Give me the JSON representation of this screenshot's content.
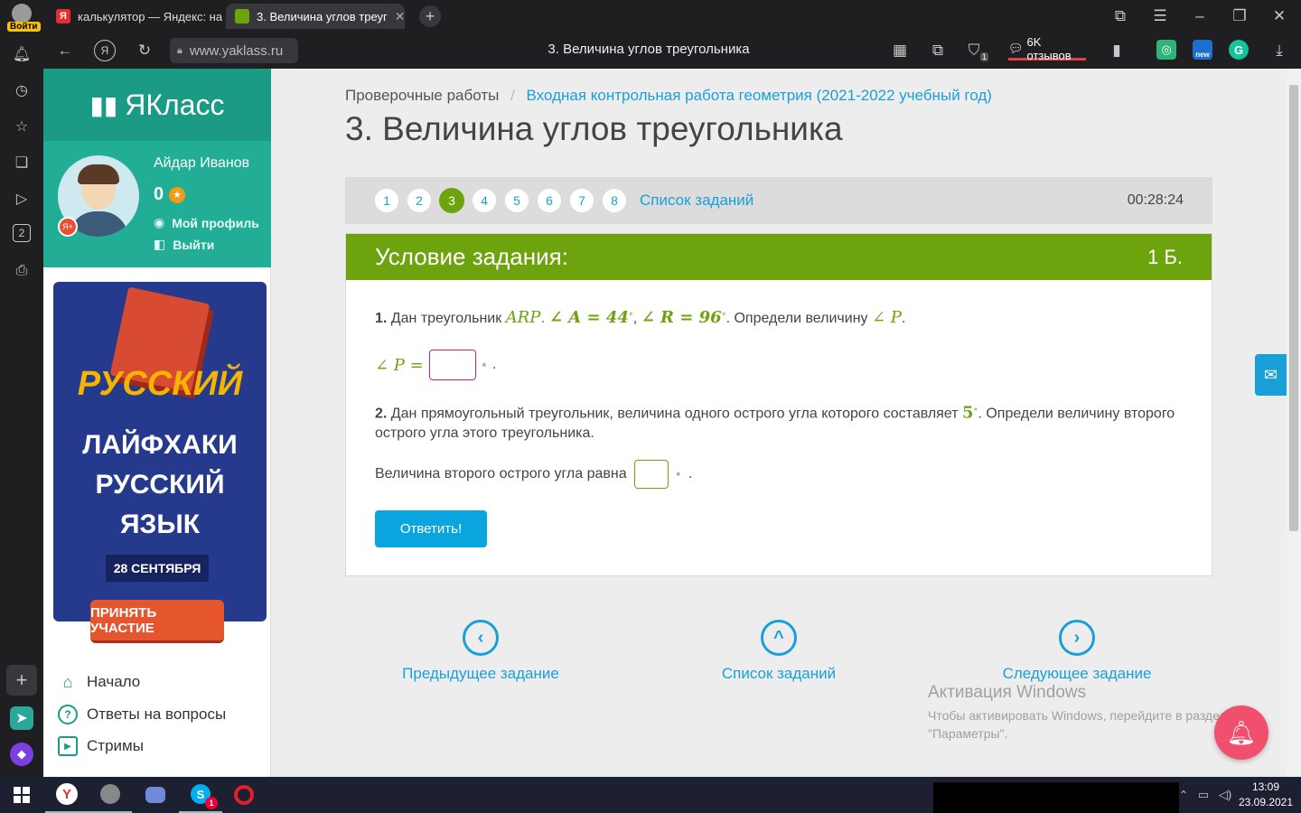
{
  "browser": {
    "login_label": "Войти",
    "tabs": [
      {
        "title": "калькулятор — Яндекс: на",
        "favicon": "Я"
      },
      {
        "title": "3. Величина углов треуг",
        "favicon": ""
      }
    ],
    "url": "www.yaklass.ru",
    "page_title": "3. Величина углов треугольника",
    "reviews": "6K отзывов",
    "new_badge": "new",
    "shield_count": "1",
    "rail_badge": "2"
  },
  "sidebar": {
    "logo": "ЯКласс",
    "user_name": "Айдар Иванов",
    "points": "0",
    "profile_link": "Мой профиль",
    "logout_link": "Выйти",
    "promo": {
      "title": "РУССКИЙ",
      "line1": "ЛАЙФХАКИ",
      "line2": "РУССКИЙ",
      "line3": "ЯЗЫК",
      "date": "28 СЕНТЯБРЯ",
      "button": "ПРИНЯТЬ УЧАСТИЕ"
    },
    "nav": [
      {
        "label": "Начало",
        "icon": "home-icon"
      },
      {
        "label": "Ответы на вопросы",
        "icon": "question-icon"
      },
      {
        "label": "Стримы",
        "icon": "play-icon"
      }
    ]
  },
  "main": {
    "breadcrumb_root": "Проверочные работы",
    "breadcrumb_sep": "/",
    "breadcrumb_link": "Входная контрольная работа геометрия (2021-2022 учебный год)",
    "title": "3. Величина углов треугольника",
    "pages": [
      "1",
      "2",
      "3",
      "4",
      "5",
      "6",
      "7",
      "8"
    ],
    "current_page": "3",
    "task_list": "Список заданий",
    "timer": "00:28:24",
    "condition_title": "Условие задания:",
    "score": "1 Б.",
    "q1": {
      "num": "1.",
      "text_a": "Дан треугольник",
      "tri": "ARP",
      "angle_a": "∠ A = 44",
      "angle_r": "∠ R = 96",
      "text_b": ". Определи величину",
      "angle_p": "∠ P",
      "answer_label": "∠ P ="
    },
    "q2": {
      "num": "2.",
      "text_a": "Дан прямоугольный треугольник, величина одного острого угла которого составляет",
      "value": "5",
      "text_b": ". Определи величину второго острого угла этого треугольника.",
      "answer_label": "Величина второго острого угла равна"
    },
    "submit": "Ответить!",
    "prev": "Предыдущее задание",
    "list": "Список заданий",
    "next": "Следующее задание"
  },
  "watermark": {
    "title": "Активация Windows",
    "line1": "Чтобы активировать Windows, перейдите в раздел",
    "line2": "\"Параметры\"."
  },
  "taskbar": {
    "time": "13:09",
    "date": "23.09.2021",
    "skype_badge": "1"
  },
  "colors": {
    "accent_teal": "#1b9a86",
    "accent_green": "#6da30d",
    "link_blue": "#1aa0d8"
  }
}
